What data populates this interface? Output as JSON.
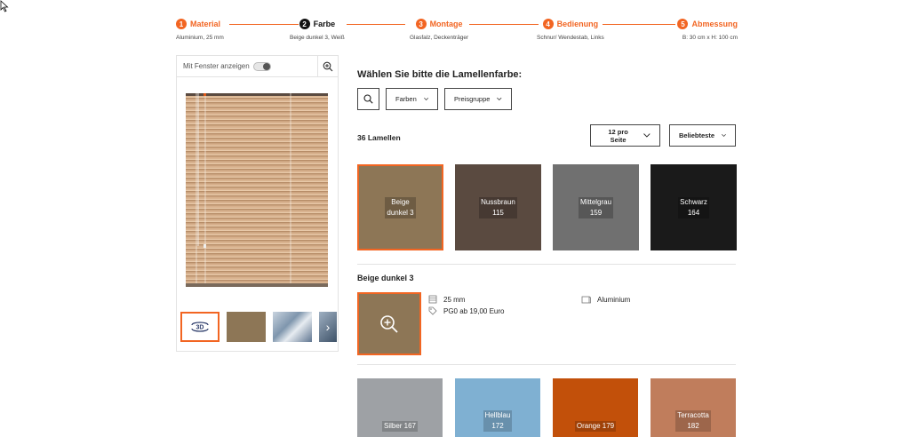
{
  "stepper": {
    "steps": [
      {
        "num": "1",
        "title": "Material",
        "sub": "Aluminium, 25 mm"
      },
      {
        "num": "2",
        "title": "Farbe",
        "sub": "Beige dunkel 3, Weiß"
      },
      {
        "num": "3",
        "title": "Montage",
        "sub": "Glasfalz, Deckenträger"
      },
      {
        "num": "4",
        "title": "Bedienung",
        "sub": "Schnur/ Wendestab, Links"
      },
      {
        "num": "5",
        "title": "Abmessung",
        "sub": "B: 30 cm x H: 100 cm"
      }
    ],
    "active_index": 1,
    "accent": "#f26522"
  },
  "preview": {
    "window_toggle_label": "Mit Fenster anzeigen",
    "thumb_3d_label": "3D"
  },
  "main": {
    "heading": "Wählen Sie bitte die Lamellenfarbe:",
    "filters": {
      "colors_label": "Farben",
      "price_group_label": "Preisgruppe"
    },
    "count_label": "36 Lamellen",
    "per_page_label": "12 pro Seite",
    "sort_label": "Beliebteste",
    "swatches": [
      {
        "name": "Beige",
        "name2": "dunkel 3",
        "code": "",
        "color": "#8d7656"
      },
      {
        "name": "Nussbraun",
        "name2": "",
        "code": "115",
        "color": "#5a4a40"
      },
      {
        "name": "Mittelgrau",
        "name2": "",
        "code": "159",
        "color": "#707070"
      },
      {
        "name": "Schwarz",
        "name2": "",
        "code": "164",
        "color": "#1a1a1a"
      }
    ],
    "detail": {
      "title": "Beige dunkel 3",
      "width_value": "25 mm",
      "price_value": "PG0 ab 19,00 Euro",
      "material_value": "Aluminium"
    },
    "swatches2": [
      {
        "label": "Silber 167",
        "label2": "",
        "color": "#9ea1a5"
      },
      {
        "label": "Hellblau",
        "label2": "172",
        "color": "#7fb0d2"
      },
      {
        "label": "Orange 179",
        "label2": "",
        "color": "#c2500a"
      },
      {
        "label": "Terracotta",
        "label2": "182",
        "color": "#c07d5c"
      }
    ]
  }
}
